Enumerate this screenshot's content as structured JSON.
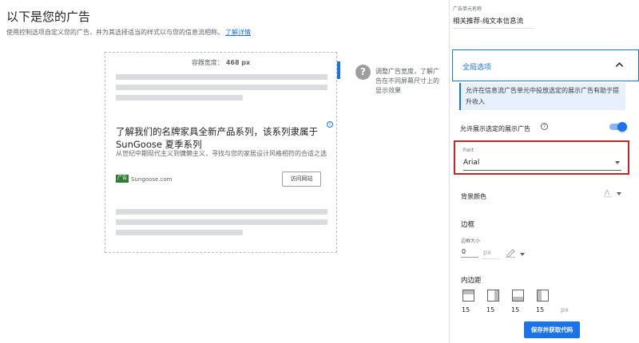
{
  "header": {
    "title": "以下是您的广告",
    "description": "使用控制选项自定义您的广告，并为其选择适当的样式以与您的信息流相称。",
    "learn_more": "了解详情"
  },
  "preview": {
    "width_label": "容器宽度：",
    "width_value": "468 px",
    "ad": {
      "info_icon": "i",
      "headline": "了解我们的名牌家具全新产品系列，该系列隶属于 SunGoose 夏季系列",
      "body": "从世纪中期现代主义到慵懒主义，寻找与您的家居设计风格相符的合适之选",
      "logo_text": "广告",
      "domain": "Sungoose.com",
      "cta": "访问网站"
    },
    "help": {
      "icon": "?",
      "text": "调整广告宽度，了解广告在不同屏幕尺寸上的显示效果"
    }
  },
  "panel": {
    "unit_name_label": "广告单元名称",
    "unit_name_value": "相关推荐-纯文本信息流",
    "global_options": {
      "title": "全局选项",
      "expanded": true,
      "info": "允许在信息流广告单元中投放选定的展示广告有助于提升收入"
    },
    "allow_display": {
      "label": "允许展示选定的展示广告",
      "help_icon": "?",
      "enabled": true
    },
    "font": {
      "label": "Font",
      "value": "Arial"
    },
    "background": {
      "label": "背景颜色"
    },
    "border": {
      "title": "边框",
      "size_label": "边框大小",
      "size_value": "0",
      "unit": "px"
    },
    "padding": {
      "title": "内边距",
      "values": [
        "15",
        "15",
        "15",
        "15"
      ],
      "unit": "px"
    },
    "save_label": "保存并获取代码"
  },
  "colors": {
    "accent": "#1a73e8",
    "highlight_border": "#c62828",
    "info_bg": "#e8f0fe",
    "placeholder_bar": "#dadce0"
  }
}
